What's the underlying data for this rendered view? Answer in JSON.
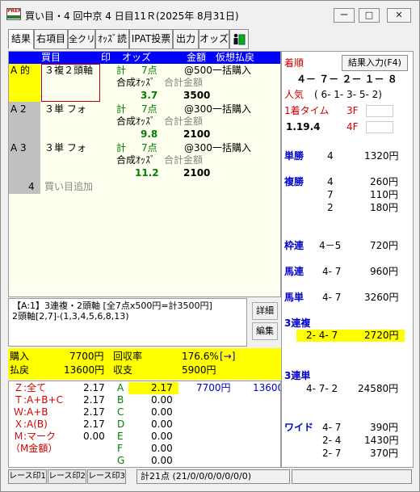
{
  "window": {
    "title": "買い目・4 回中京 4 日目11Ｒ(2025年 8月31日)",
    "min": "ー",
    "max": "□",
    "close": "✕",
    "icon": "PREM"
  },
  "toolbar": {
    "items": [
      "結果",
      "右項目",
      "全クリア",
      "ｵｯｽﾞ読",
      "IPAT投票",
      "出力",
      "オッズ"
    ]
  },
  "table": {
    "headers": {
      "kaime": "買目",
      "shirushi": "印",
      "odds": "オッズ",
      "kingaku": "金額",
      "harai": "仮想払戻"
    },
    "rows": [
      {
        "label": "A 的",
        "type": "３複２頭軸",
        "kei": "計",
        "points": "7点",
        "amount": "@500",
        "mode": "一括購入",
        "comp_label": "合成ｵｯｽﾞ",
        "total_label": "合計金額",
        "comp": "3.7",
        "total": "3500"
      },
      {
        "label": "A  2",
        "type": "３単 フォ",
        "kei": "計",
        "points": "7点",
        "amount": "@300",
        "mode": "一括購入",
        "comp_label": "合成ｵｯｽﾞ",
        "total_label": "合計金額",
        "comp": "9.8",
        "total": "2100"
      },
      {
        "label": "A  3",
        "type": "３単 フォ",
        "kei": "計",
        "points": "7点",
        "amount": "@300",
        "mode": "一括購入",
        "comp_label": "合成ｵｯｽﾞ",
        "total_label": "合計金額",
        "comp": "11.2",
        "total": "2100"
      }
    ],
    "add_row": {
      "num": "4",
      "label": "買い目追加"
    }
  },
  "desc": {
    "line1": "【A:1】3連複・2頭軸 [全7点x500円=計3500円]",
    "line2": "2頭軸[2,7]-(1,3,4,5,6,8,13)",
    "btn_detail": "詳細",
    "btn_edit": "編集"
  },
  "summary": {
    "buy_label": "購入",
    "buy": "7700円",
    "ret_label": "回収率",
    "ret": "176.6%",
    "ret_btn": "[→]",
    "pay_label": "払戻",
    "pay": "13600円",
    "bal_label": "収支",
    "bal": "5900円"
  },
  "stats": {
    "left": [
      {
        "key": "Ｚ:全て",
        "val": "2.17"
      },
      {
        "key": "Ｔ:A+B+C",
        "val": "2.17"
      },
      {
        "key": "Ｗ:A+B",
        "val": "2.17"
      },
      {
        "key": "Ｘ:A(B)",
        "val": "2.17"
      },
      {
        "key": "Ｍ:マーク",
        "val": "0.00"
      },
      {
        "key": "（M金額）",
        "val": ""
      }
    ],
    "right": [
      {
        "key": "A",
        "val": "2.17",
        "buy": "7700円",
        "pay": "13600"
      },
      {
        "key": "B",
        "val": "0.00"
      },
      {
        "key": "C",
        "val": "0.00"
      },
      {
        "key": "D",
        "val": "0.00"
      },
      {
        "key": "E",
        "val": "0.00"
      },
      {
        "key": "F",
        "val": "0.00"
      },
      {
        "key": "G",
        "val": "0.00"
      }
    ]
  },
  "result": {
    "chaku_label": "着順",
    "btn": "結果入力(F4)",
    "order": "４－ ７－ ２－ １－ ８",
    "ninki_label": "人気",
    "ninki": "( 6- 1- 3- 5- 2)",
    "time_label": "1着タイム",
    "time": "1.19.4",
    "f3_label": "3F",
    "f4_label": "4F",
    "payouts": [
      {
        "type": "単勝",
        "lines": [
          {
            "combo": "4",
            "amt": "1320円"
          }
        ]
      },
      {
        "type": "複勝",
        "lines": [
          {
            "combo": "4",
            "amt": "260円"
          },
          {
            "combo": "7",
            "amt": "110円"
          },
          {
            "combo": "2",
            "amt": "180円"
          }
        ]
      },
      {
        "type": "枠連",
        "lines": [
          {
            "combo": "4－5",
            "amt": "720円"
          }
        ]
      },
      {
        "type": "馬連",
        "lines": [
          {
            "combo": "4- 7",
            "amt": "960円"
          }
        ]
      },
      {
        "type": "馬単",
        "lines": [
          {
            "combo": "4- 7",
            "amt": "3260円"
          }
        ]
      },
      {
        "type": "3連複",
        "lines": [
          {
            "combo": "2- 4- 7",
            "amt": "2720円"
          }
        ]
      },
      {
        "type": "3連単",
        "lines": [
          {
            "combo": "4- 7- 2",
            "amt": "24580円"
          }
        ]
      },
      {
        "type": "ワイド",
        "lines": [
          {
            "combo": "4- 7",
            "amt": "390円"
          },
          {
            "combo": "2- 4",
            "amt": "1430円"
          },
          {
            "combo": "2- 7",
            "amt": "370円"
          }
        ]
      }
    ]
  },
  "tabs": [
    "レース印1",
    "レース印2",
    "レース印3"
  ],
  "status": "計21点 (21/0/0/0/0/0/0/0)",
  "colors": {
    "header": "#0000ff",
    "highlight": "#ffff00",
    "result_label": "#d00000",
    "bet_label": "#0000cc",
    "odds": "#008000"
  }
}
